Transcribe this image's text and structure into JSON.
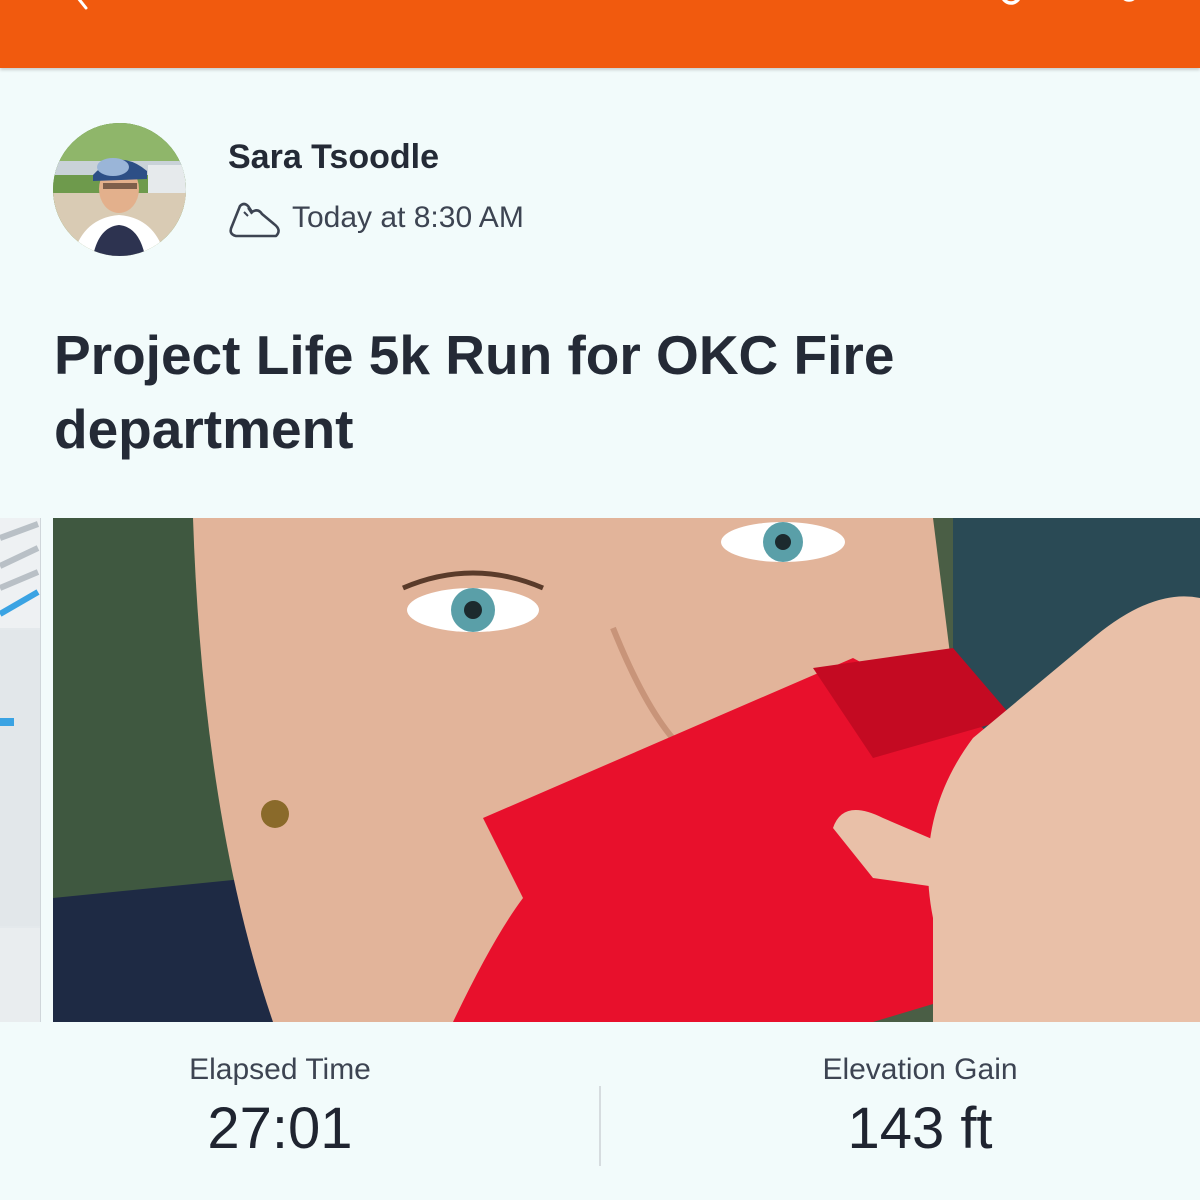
{
  "header": {
    "back_icon": "chevron-left-icon",
    "actions": [
      "share-icon",
      "more-icon"
    ],
    "color": "#f15a0e"
  },
  "activity": {
    "author": "Sara Tsoodle",
    "sport_icon": "running-shoe-icon",
    "timestamp": "Today at 8:30 AM",
    "title": "Project Life 5k Run for OKC Fire department"
  },
  "stats": [
    {
      "label": "Elapsed Time",
      "value": "27:01"
    },
    {
      "label": "Elevation Gain",
      "value": "143 ft"
    }
  ]
}
